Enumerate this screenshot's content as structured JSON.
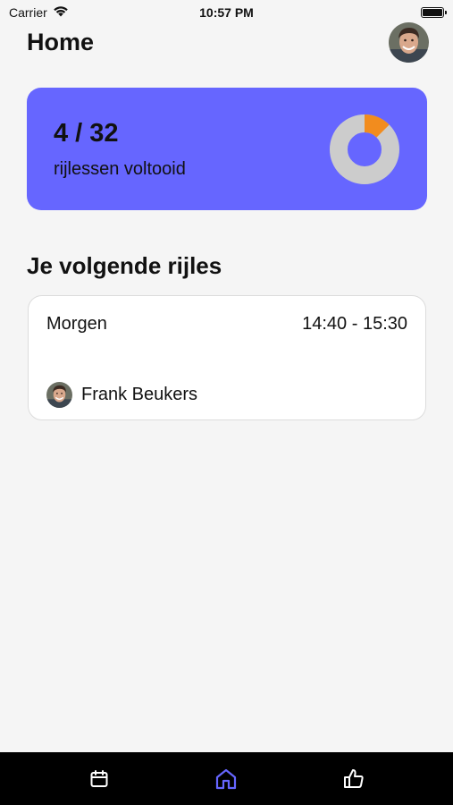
{
  "status_bar": {
    "carrier": "Carrier",
    "time": "10:57 PM"
  },
  "header": {
    "title": "Home"
  },
  "progress": {
    "completed": 4,
    "total": 32,
    "count_text": "4 / 32",
    "label": "rijlessen voltooid",
    "fraction": 0.125,
    "accent_color": "#f28c1e",
    "track_color": "#cccccc",
    "card_color": "#6666ff"
  },
  "next_lesson": {
    "section_title": "Je volgende rijles",
    "day": "Morgen",
    "time_range": "14:40 - 15:30",
    "instructor": "Frank Beukers"
  },
  "tab_bar": {
    "items": [
      {
        "icon": "calendar-icon",
        "active": false
      },
      {
        "icon": "home-icon",
        "active": true
      },
      {
        "icon": "thumbs-up-icon",
        "active": false
      }
    ],
    "active_color": "#6666ff",
    "inactive_color": "#ffffff"
  }
}
